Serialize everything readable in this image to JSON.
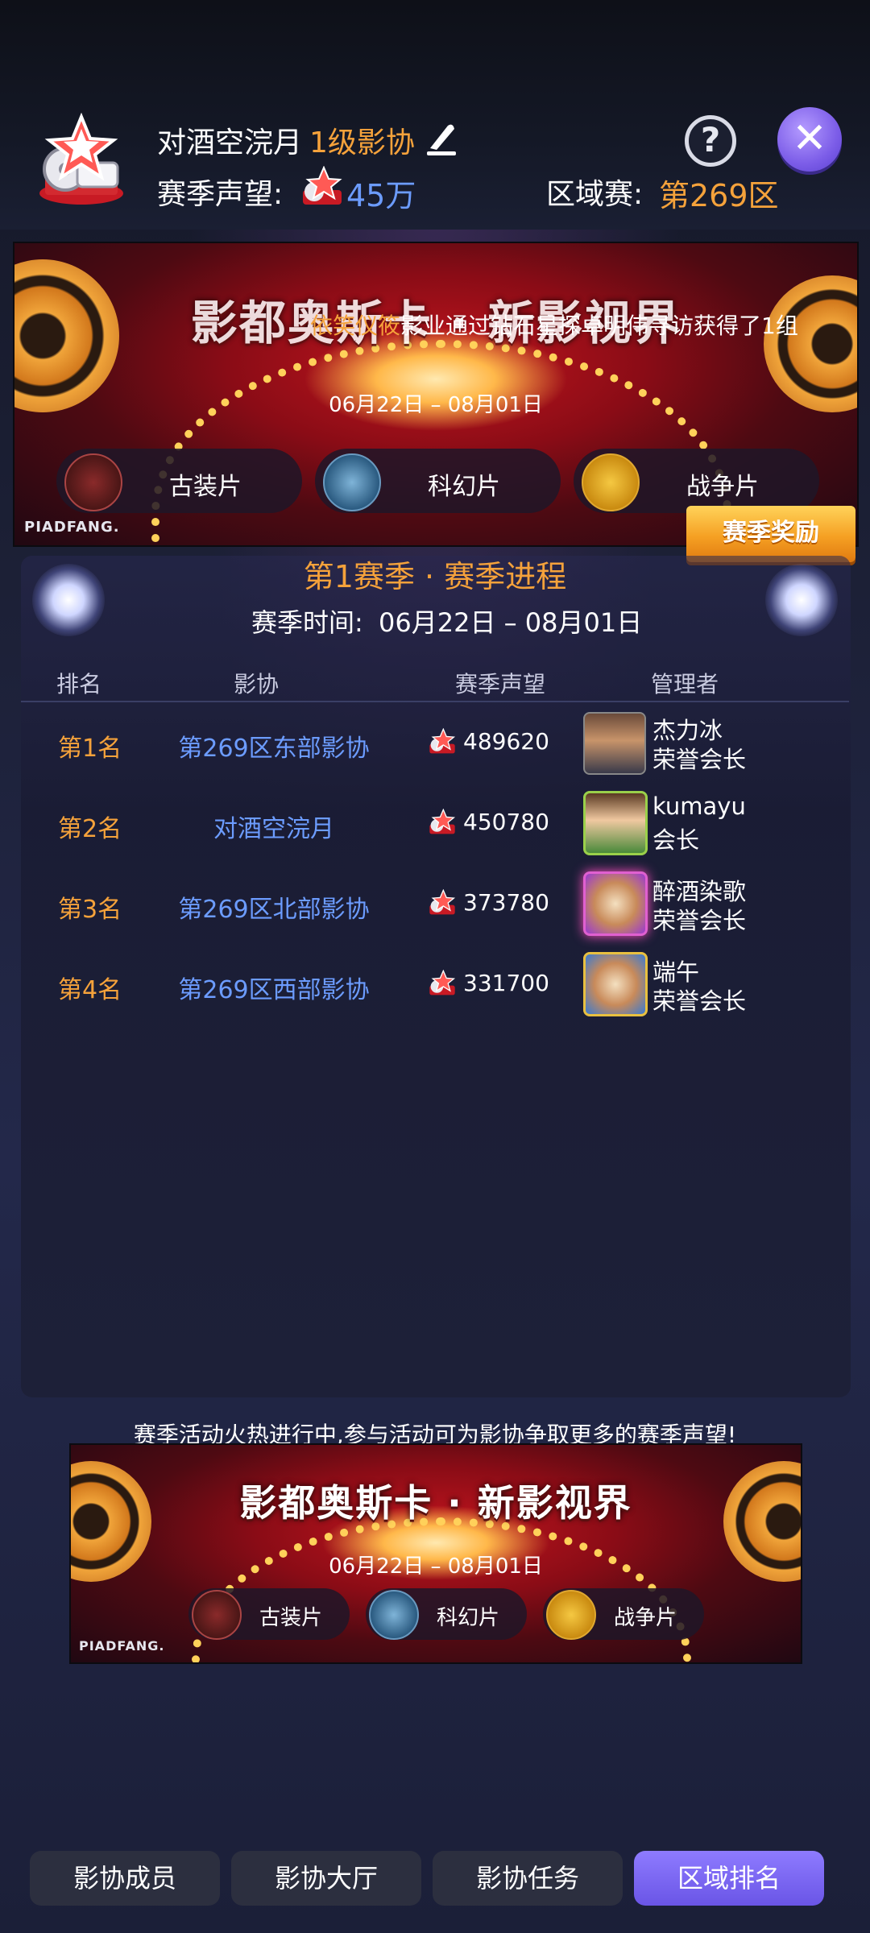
{
  "header": {
    "guild_name": "对酒空浣月",
    "level": "1级影协",
    "reputation_label": "赛季声望:",
    "reputation_value": "45万",
    "region_label": "区域赛:",
    "region_value": "第269区",
    "help_label": "?",
    "close_label": "✕"
  },
  "top_banner": {
    "title": "影都奥斯卡 · 新影视界",
    "date": "06月22日 – 08月01日",
    "brand": "PIADFANG.",
    "chips": [
      "古装片",
      "科幻片",
      "战争片"
    ],
    "marquee_highlight": "依笑仪筱",
    "marquee_text": "影业通过钻石星探卓明伟寻访获得了1组E"
  },
  "reward_button": "赛季奖励",
  "season": {
    "title": "第1赛季 · 赛季进程",
    "time_label": "赛季时间:",
    "time_value": "06月22日 – 08月01日"
  },
  "table": {
    "headers": [
      "排名",
      "影协",
      "赛季声望",
      "管理者"
    ],
    "rows": [
      {
        "rank": "第1名",
        "guild": "第269区东部影协",
        "reputation": "489620",
        "admin": "杰力冰",
        "role": "荣誉会长"
      },
      {
        "rank": "第2名",
        "guild": "对酒空浣月",
        "reputation": "450780",
        "admin": "kumayu",
        "role": "会长"
      },
      {
        "rank": "第3名",
        "guild": "第269区北部影协",
        "reputation": "373780",
        "admin": "醉酒染歌",
        "role": "荣誉会长"
      },
      {
        "rank": "第4名",
        "guild": "第269区西部影协",
        "reputation": "331700",
        "admin": "端午",
        "role": "荣誉会长"
      }
    ]
  },
  "promo": {
    "text": "赛季活动火热进行中,参与活动可为影协争取更多的赛季声望!",
    "banner_title": "影都奥斯卡 · 新影视界",
    "banner_date": "06月22日 – 08月01日",
    "brand": "PIADFANG.",
    "chips": [
      "古装片",
      "科幻片",
      "战争片"
    ]
  },
  "tabs": [
    "影协成员",
    "影协大厅",
    "影协任务",
    "区域排名"
  ],
  "colors": {
    "accent_orange": "#f5a23b",
    "accent_blue": "#6c9cff",
    "active_tab": "#7b68f0"
  }
}
